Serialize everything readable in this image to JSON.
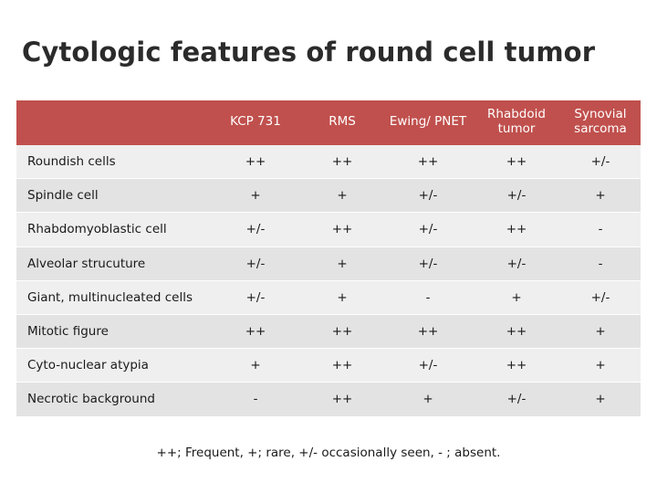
{
  "title": "Cytologic features of round cell tumor",
  "table": {
    "corner_label": "",
    "columns": [
      "KCP 731",
      "RMS",
      "Ewing/ PNET",
      "Rhabdoid tumor",
      "Synovial sarcoma"
    ],
    "rows": [
      {
        "label": "Roundish cells",
        "values": [
          "++",
          "++",
          "++",
          "++",
          "+/-"
        ]
      },
      {
        "label": "Spindle cell",
        "values": [
          "+",
          "+",
          "+/-",
          "+/-",
          "+"
        ]
      },
      {
        "label": "Rhabdomyoblastic cell",
        "values": [
          "+/-",
          "++",
          "+/-",
          "++",
          "-"
        ]
      },
      {
        "label": "Alveolar strucuture",
        "values": [
          "+/-",
          "+",
          "+/-",
          "+/-",
          "-"
        ]
      },
      {
        "label": "Giant,    multinucleated cells",
        "values": [
          "+/-",
          "+",
          "-",
          "+",
          "+/-"
        ]
      },
      {
        "label": "Mitotic figure",
        "values": [
          "++",
          "++",
          "++",
          "++",
          "+"
        ]
      },
      {
        "label": "Cyto-nuclear atypia",
        "values": [
          "+",
          "++",
          "+/-",
          "++",
          "+"
        ]
      },
      {
        "label": "Necrotic background",
        "values": [
          "-",
          "++",
          "+",
          "+/-",
          "+"
        ]
      }
    ]
  },
  "footnote": "++; Frequent, +; rare, +/- occasionally seen, - ; absent.",
  "colors": {
    "header_background": "#c0504d",
    "header_text": "#ffffff",
    "row_band_light": "#efefef",
    "row_band_dark": "#e3e3e3",
    "title_text": "#2b2b2b"
  }
}
